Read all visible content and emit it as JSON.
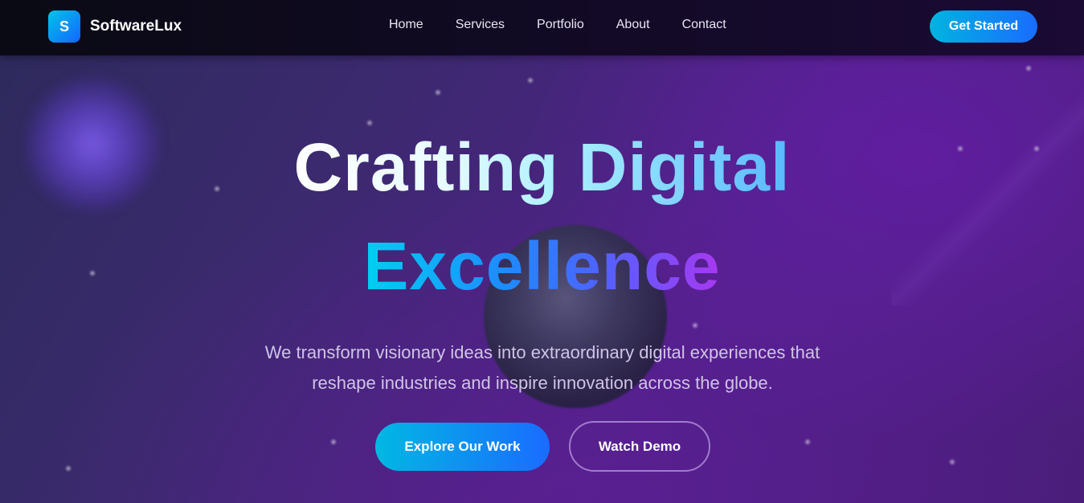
{
  "brand": {
    "logo_letter": "S",
    "name": "SoftwareLux"
  },
  "nav": {
    "links": [
      {
        "label": "Home"
      },
      {
        "label": "Services"
      },
      {
        "label": "Portfolio"
      },
      {
        "label": "About"
      },
      {
        "label": "Contact"
      }
    ],
    "cta_label": "Get Started"
  },
  "hero": {
    "title_line1": "Crafting Digital",
    "title_line2": "Excellence",
    "subtitle_line1": "We transform visionary ideas into extraordinary digital experiences that",
    "subtitle_line2": "reshape industries and inspire innovation across the globe.",
    "primary_button": "Explore Our Work",
    "secondary_button": "Watch Demo"
  },
  "colors": {
    "accent_start": "#00b8e2",
    "accent_end": "#1a6cff",
    "background": "#51208a"
  }
}
